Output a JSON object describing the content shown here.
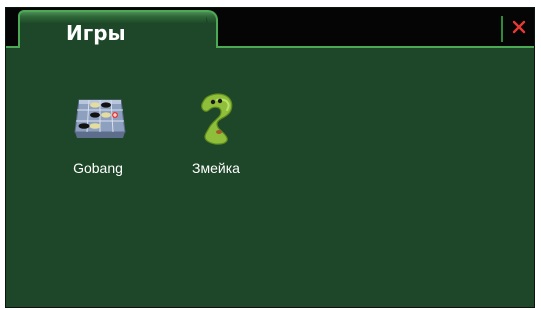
{
  "window": {
    "title": "Игры"
  },
  "titlebar": {
    "close_icon": "close-icon",
    "close_color": "#e53935"
  },
  "colors": {
    "background": "#1d4728",
    "accent": "#4caa55",
    "titlebar": "#050505",
    "text": "#ffffff"
  },
  "apps": [
    {
      "label": "Gobang",
      "icon": "gobang-board-icon"
    },
    {
      "label": "Змейка",
      "icon": "snake-icon"
    }
  ]
}
